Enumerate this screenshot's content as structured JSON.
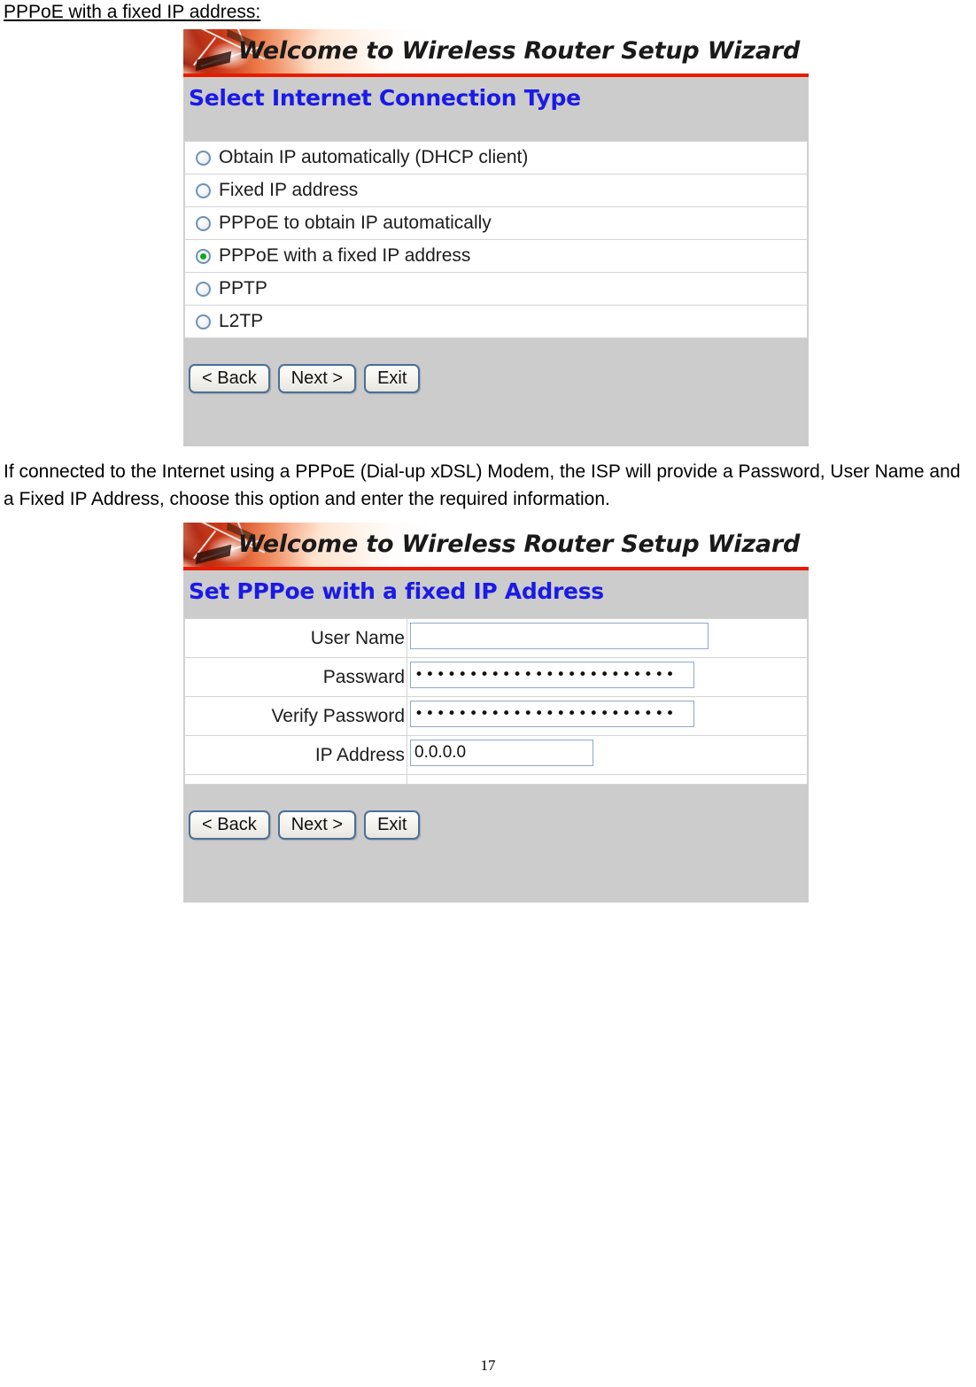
{
  "document": {
    "heading": "PPPoE with a fixed IP address:",
    "paragraph": "If connected to the Internet using a PPPoE (Dial-up xDSL) Modem, the ISP will provide a Password, User Name and a Fixed IP Address, choose this option and enter the required information.",
    "page_number": "17"
  },
  "colors": {
    "heading_blue": "#1a1ae6",
    "banner_rule_red": "#e81b00",
    "panel_gray": "#cccccc",
    "radio_selected_green": "#0fa81a",
    "button_border_blue": "#4a6f97",
    "field_border_blue": "#8fa9c6"
  },
  "panel_one": {
    "banner_title": "Welcome to Wireless Router Setup Wizard",
    "page_heading": "Select Internet Connection Type",
    "options": [
      {
        "label": "Obtain IP automatically (DHCP client)",
        "selected": false
      },
      {
        "label": "Fixed IP address",
        "selected": false
      },
      {
        "label": "PPPoE to obtain IP automatically",
        "selected": false
      },
      {
        "label": "PPPoE with a fixed IP address",
        "selected": true
      },
      {
        "label": "PPTP",
        "selected": false
      },
      {
        "label": "L2TP",
        "selected": false
      }
    ],
    "buttons": {
      "back": "< Back",
      "next": "Next >",
      "exit": "Exit"
    }
  },
  "panel_two": {
    "banner_title": "Welcome to Wireless Router Setup Wizard",
    "page_heading_prefix": "Set PPP",
    "page_heading_lower": "oe",
    "page_heading_suffix": " with a fixed IP Address",
    "fields": [
      {
        "label": "User Name",
        "value": "",
        "placeholder": "",
        "masked": false
      },
      {
        "label": "Passward",
        "value": "••••••••••••••••••••••••",
        "placeholder": "",
        "masked": true
      },
      {
        "label": "Verify Password",
        "value": "••••••••••••••••••••••••",
        "placeholder": "",
        "masked": true
      },
      {
        "label": "IP Address",
        "value": "0.0.0.0",
        "placeholder": "",
        "masked": false
      }
    ],
    "buttons": {
      "back": "< Back",
      "next": "Next >",
      "exit": "Exit"
    }
  }
}
